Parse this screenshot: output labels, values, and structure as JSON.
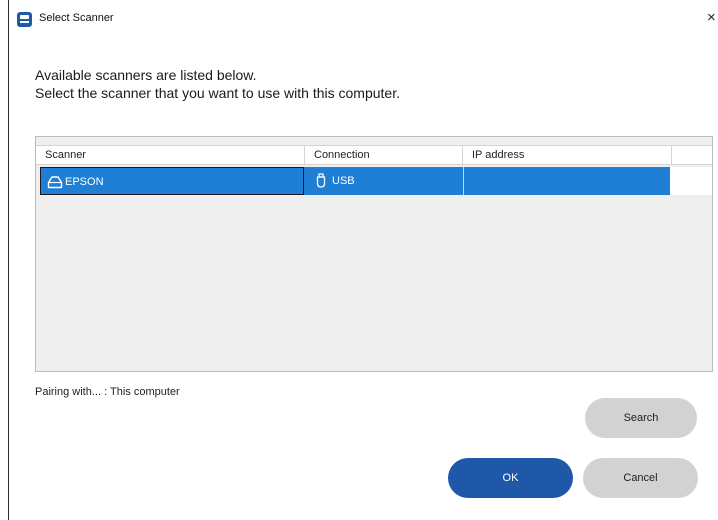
{
  "window": {
    "title": "Select Scanner",
    "close_glyph": "×"
  },
  "instructions": {
    "line1": "Available scanners are listed below.",
    "line2": "Select the scanner that you want to use with this computer."
  },
  "table": {
    "columns": [
      "Scanner",
      "Connection",
      "IP address"
    ],
    "rows": [
      {
        "scanner": "EPSON",
        "connection": "USB",
        "ip": "",
        "selected": true,
        "scanner_icon": "scanner-icon",
        "connection_icon": "usb-icon"
      }
    ]
  },
  "pairing_text": "Pairing with... : This computer",
  "buttons": {
    "search": "Search",
    "ok": "OK",
    "cancel": "Cancel"
  },
  "colors": {
    "accent": "#1f57a9",
    "selection": "#1f7fd4",
    "secondary_button": "#d2d2d2"
  }
}
